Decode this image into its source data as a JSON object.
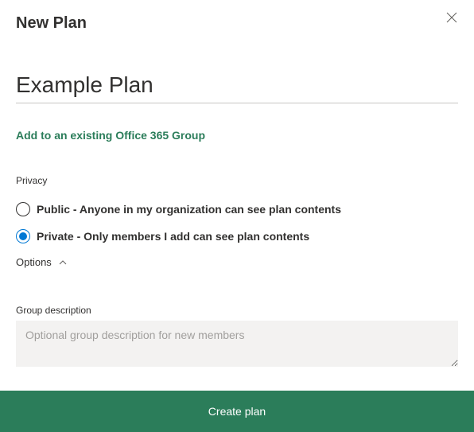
{
  "header": {
    "title": "New Plan"
  },
  "form": {
    "plan_name_value": "Example Plan",
    "add_group_link": "Add to an existing Office 365 Group",
    "privacy_label": "Privacy",
    "privacy_options": [
      {
        "label": "Public - Anyone in my organization can see plan contents",
        "selected": false
      },
      {
        "label": "Private - Only members I add can see plan contents",
        "selected": true
      }
    ],
    "options_label": "Options",
    "group_desc_label": "Group description",
    "group_desc_placeholder": "Optional group description for new members",
    "group_desc_value": ""
  },
  "actions": {
    "create_label": "Create plan"
  },
  "colors": {
    "accent": "#2b7d5a",
    "radio_selected": "#0078d4"
  }
}
